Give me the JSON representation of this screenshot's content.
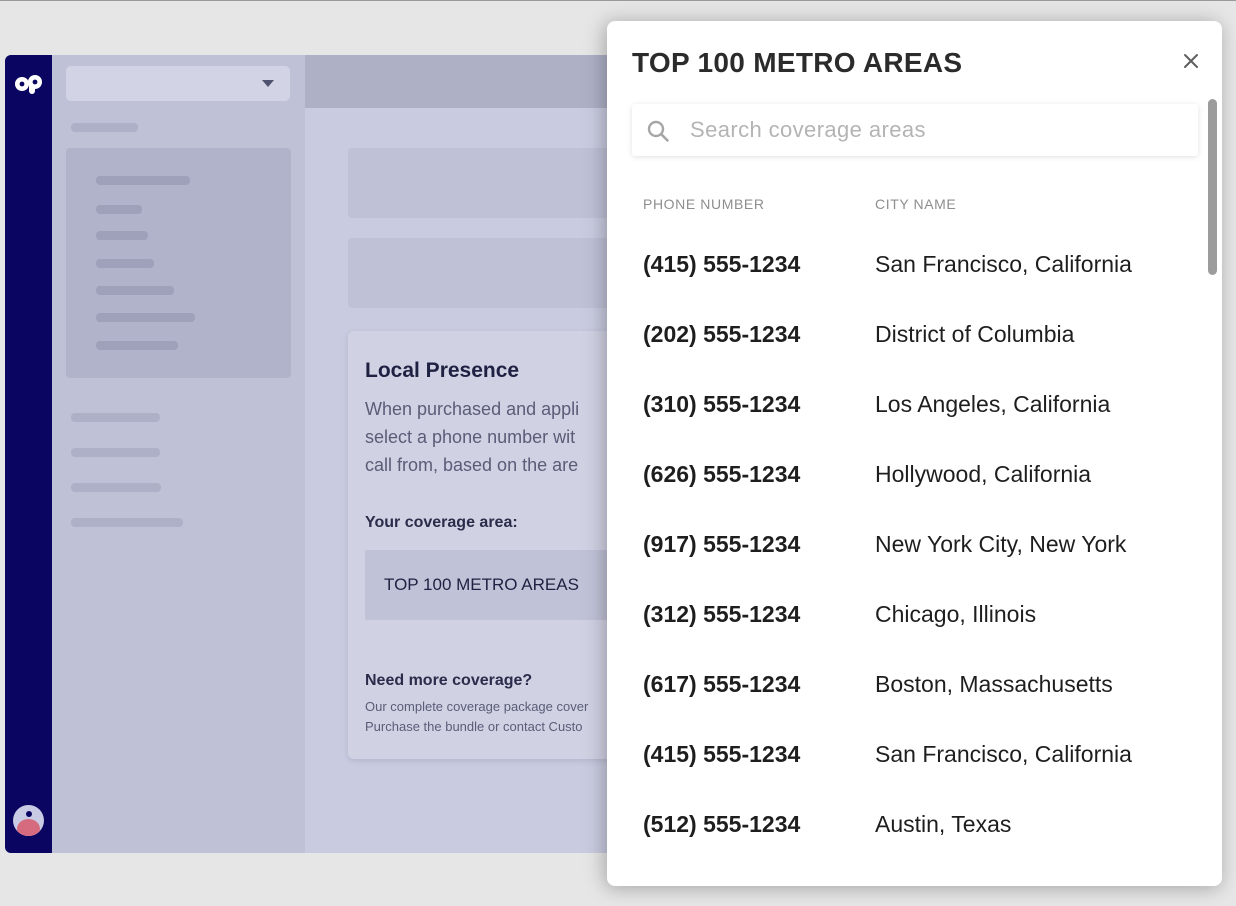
{
  "background_app": {
    "card": {
      "title": "Local Presence",
      "description": "When purchased and appli\nselect a phone number wit\ncall from, based on the are",
      "coverage_label": "Your coverage area:",
      "coverage_value": "TOP 100 METRO AREAS",
      "more_title": "Need more coverage?",
      "more_text": "Our complete coverage package cover\nPurchase the bundle or contact Custo"
    }
  },
  "modal": {
    "title": "TOP 100 METRO AREAS",
    "close_icon": "close-icon",
    "search": {
      "placeholder": "Search coverage areas",
      "value": "",
      "icon": "search-icon"
    },
    "columns": {
      "phone": "PHONE NUMBER",
      "city": "CITY NAME"
    },
    "rows": [
      {
        "phone": "(415) 555-1234",
        "city": "San Francisco, California"
      },
      {
        "phone": "(202) 555-1234",
        "city": "District of Columbia"
      },
      {
        "phone": "(310) 555-1234",
        "city": "Los Angeles, California"
      },
      {
        "phone": "(626) 555-1234",
        "city": "Hollywood, California"
      },
      {
        "phone": "(917) 555-1234",
        "city": "New York City, New York"
      },
      {
        "phone": "(312) 555-1234",
        "city": "Chicago, Illinois"
      },
      {
        "phone": "(617) 555-1234",
        "city": "Boston, Massachusetts"
      },
      {
        "phone": "(415) 555-1234",
        "city": "San Francisco, California"
      },
      {
        "phone": "(512) 555-1234",
        "city": "Austin, Texas"
      }
    ]
  },
  "colors": {
    "rail": "#0a0560",
    "overlay_tint": "#c7c9de",
    "modal_bg": "#ffffff",
    "text_primary": "#1e1e1e",
    "text_muted": "#8e8e8e",
    "avatar_accent": "#d66b80"
  }
}
